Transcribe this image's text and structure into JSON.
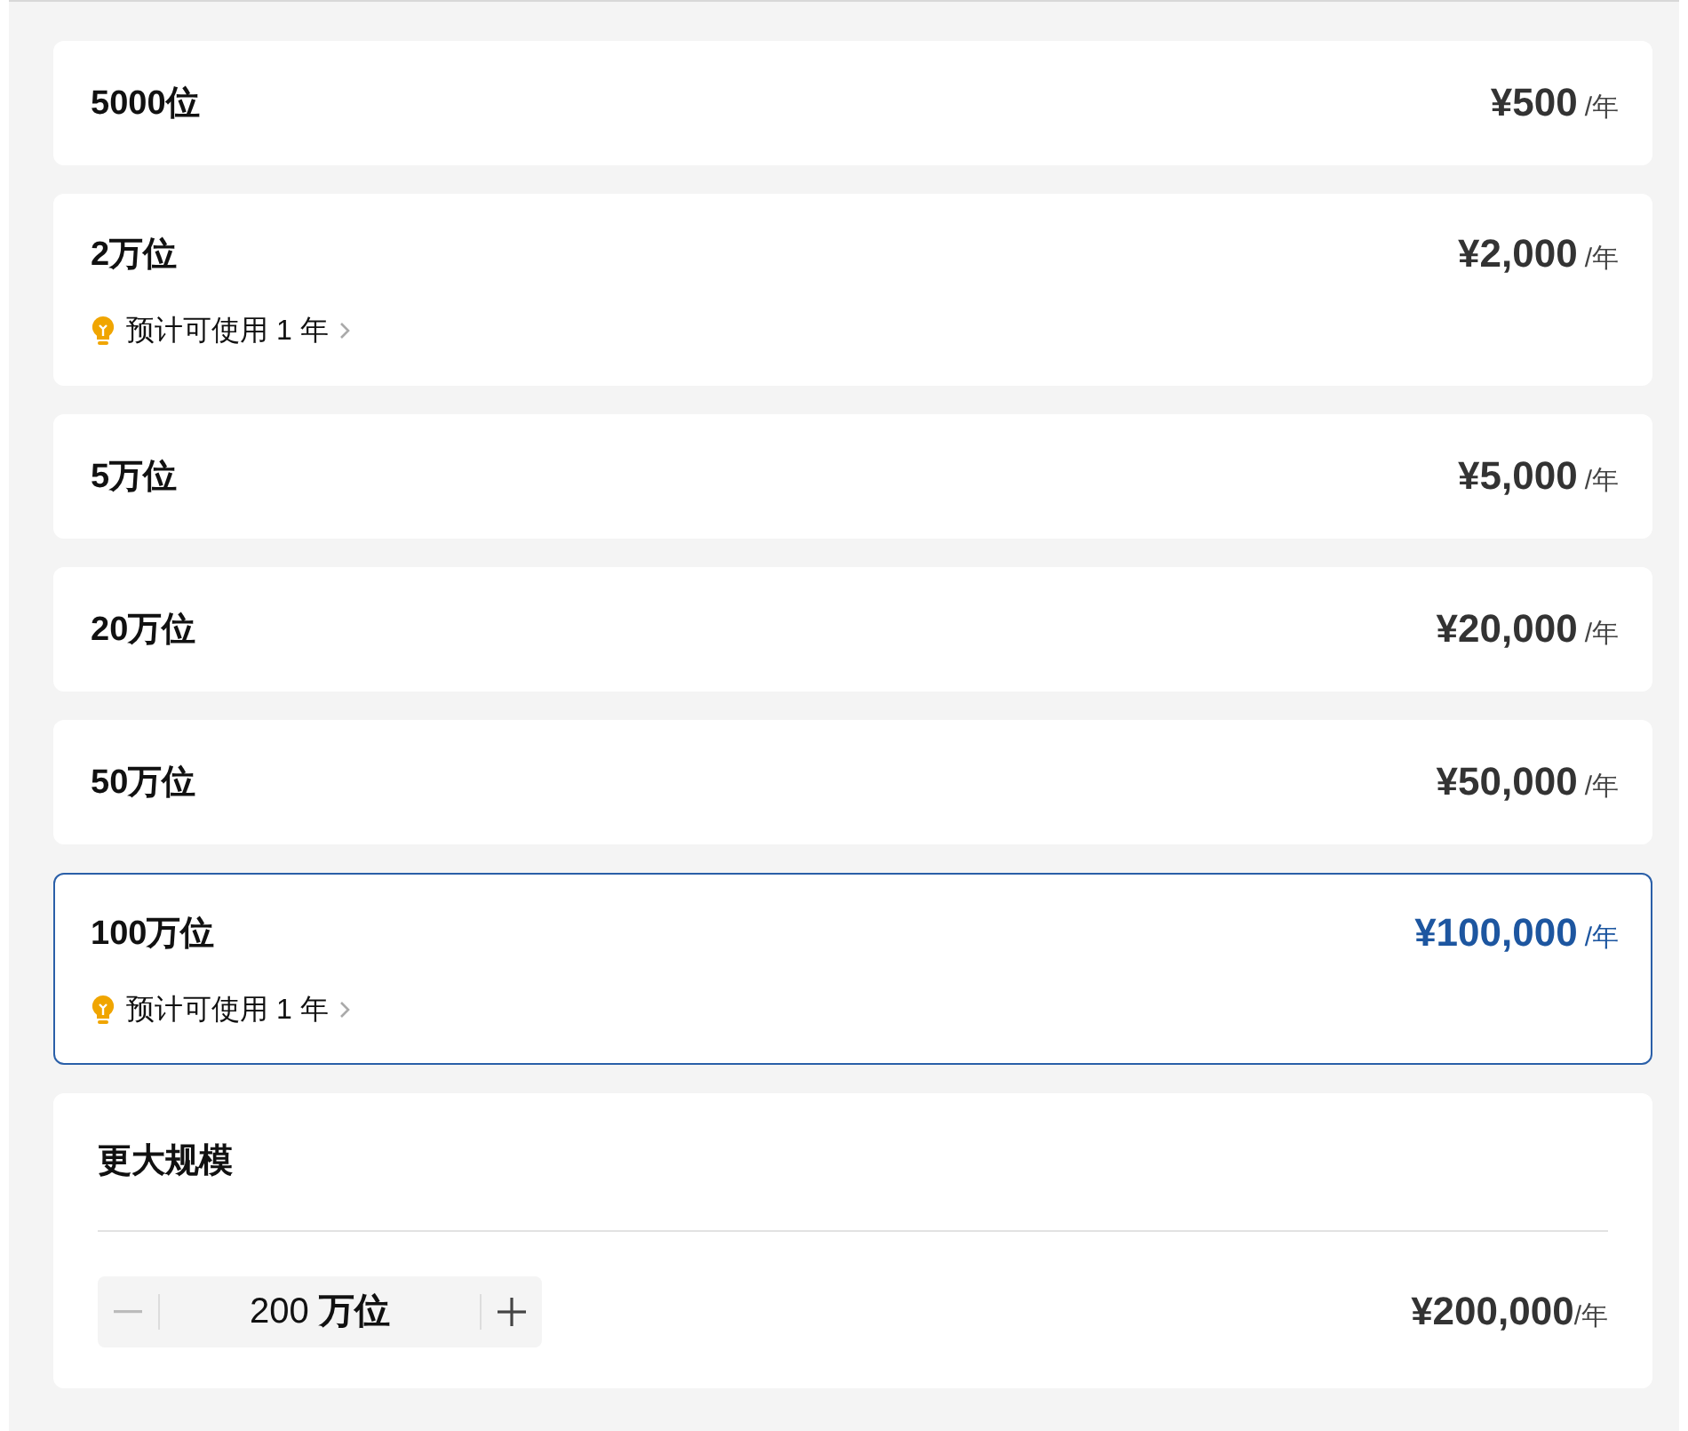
{
  "plans": [
    {
      "name": "5000位",
      "price": "¥500",
      "per": "/年",
      "selected": false
    },
    {
      "name": "2万位",
      "price": "¥2,000",
      "per": "/年",
      "hint": "预计可使用 1 年",
      "selected": false
    },
    {
      "name": "5万位",
      "price": "¥5,000",
      "per": "/年",
      "selected": false
    },
    {
      "name": "20万位",
      "price": "¥20,000",
      "per": "/年",
      "selected": false
    },
    {
      "name": "50万位",
      "price": "¥50,000",
      "per": "/年",
      "selected": false
    },
    {
      "name": "100万位",
      "price": "¥100,000",
      "per": "/年",
      "hint": "预计可使用 1 年",
      "selected": true
    }
  ],
  "custom": {
    "title": "更大规模",
    "quantity": "200",
    "unit": "万位",
    "minus_disabled": true,
    "plus_disabled": false,
    "price": "¥200,000",
    "per": "/年"
  }
}
